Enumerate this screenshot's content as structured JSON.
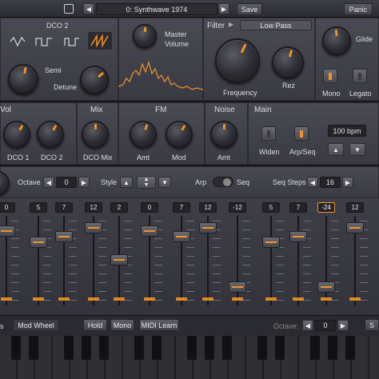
{
  "header": {
    "preset_name": "0: Synthwave 1974",
    "save_label": "Save",
    "panic_label": "Panic",
    "prev_icon": "triangle-left-icon",
    "next_icon": "triangle-right-icon",
    "dice_icon": "dice-icon"
  },
  "dco2": {
    "title": "DCO 2",
    "semi_label": "Semi",
    "detune_label": "Detune",
    "waves": [
      "sine-wave-icon",
      "square-wave-icon",
      "pulse-wave-icon",
      "saw-wave-icon"
    ],
    "selected_wave": 3
  },
  "master": {
    "label_line1": "Master",
    "label_line2": "Volume"
  },
  "filter": {
    "title": "Filter",
    "mode": "Low Pass",
    "frequency_label": "Frequency",
    "rez_label": "Rez"
  },
  "glide": {
    "label": "Glide"
  },
  "toggles": {
    "mono_label": "Mono",
    "legato_label": "Legato"
  },
  "mix_section": {
    "vol_title": "Vol",
    "mix_title": "Mix",
    "fm_title": "FM",
    "noise_title": "Noise",
    "main_title": "Main",
    "dco1_label": "DCO 1",
    "dco2_label": "DCO 2",
    "dco_mix_label": "DCO Mix",
    "fm_amt_label": "Amt",
    "fm_mod_label": "Mod",
    "noise_amt_label": "Amt",
    "widen_label": "Widen",
    "arpseq_label": "Arp/Seq",
    "bpm_value": "100 bpm"
  },
  "seq_controls": {
    "octave_label": "Octave",
    "octave_value": "0",
    "style_label": "Style",
    "arp_label": "Arp",
    "seq_label": "Seq",
    "steps_label": "Seq Steps",
    "steps_value": "16"
  },
  "steps": [
    "0",
    "5",
    "7",
    "12",
    "2",
    "0",
    "7",
    "12",
    "-12",
    "5",
    "7",
    "-24",
    "12"
  ],
  "active_step": 11,
  "bottom": {
    "mod_wheel_label": "Mod Wheel",
    "hold_label": "Hold",
    "mono_label": "Mono",
    "midi_learn_label": "MIDI Learn",
    "octave_label": "Octave:",
    "octave_value": "0",
    "partial_label": "S",
    "partial_left_label": "s"
  },
  "colors": {
    "accent": "#f29325",
    "panel": "#45454e",
    "background": "#17171b"
  }
}
